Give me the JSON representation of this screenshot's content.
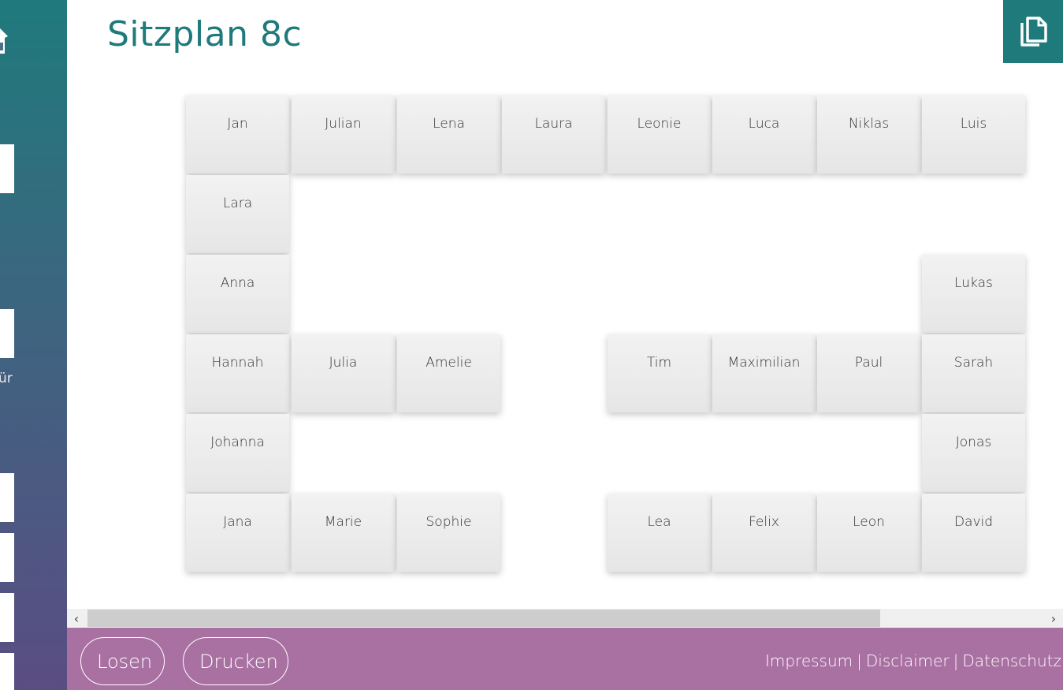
{
  "page": {
    "title": "Sitzplan 8c",
    "partial_sidebar_text": "ür"
  },
  "colors": {
    "accent": "#1f7a7c",
    "footer": "#a970a2",
    "seat": "#ebebeb"
  },
  "icons": {
    "home": "home-icon",
    "copy": "copy-icon"
  },
  "seats": [
    {
      "name": "Jan"
    },
    {
      "name": "Julian"
    },
    {
      "name": "Lena"
    },
    {
      "name": "Laura"
    },
    {
      "name": "Leonie"
    },
    {
      "name": "Luca"
    },
    {
      "name": "Niklas"
    },
    {
      "name": "Luis"
    },
    {
      "name": "Lara"
    },
    {
      "name": "Anna"
    },
    {
      "name": "Lukas"
    },
    {
      "name": "Hannah"
    },
    {
      "name": "Julia"
    },
    {
      "name": "Amelie"
    },
    {
      "name": "Tim"
    },
    {
      "name": "Maximilian"
    },
    {
      "name": "Paul"
    },
    {
      "name": "Sarah"
    },
    {
      "name": "Johanna"
    },
    {
      "name": "Jonas"
    },
    {
      "name": "Jana"
    },
    {
      "name": "Marie"
    },
    {
      "name": "Sophie"
    },
    {
      "name": "Lea"
    },
    {
      "name": "Felix"
    },
    {
      "name": "Leon"
    },
    {
      "name": "David"
    }
  ],
  "scrollbar": {
    "left_arrow": "‹",
    "right_arrow": "›"
  },
  "footer": {
    "losen_label": "Losen",
    "drucken_label": "Drucken",
    "links": {
      "impressum": "Impressum",
      "disclaimer": "Disclaimer",
      "datenschutz": "Datenschutz",
      "separator": "|"
    }
  }
}
